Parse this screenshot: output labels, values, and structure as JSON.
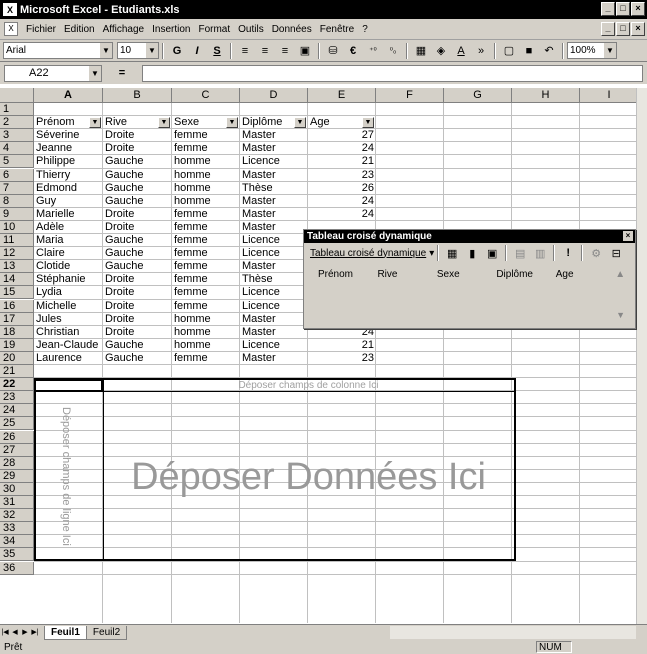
{
  "titlebar": {
    "title": "Microsoft Excel - Etudiants.xls",
    "minimize": "_",
    "restore": "□",
    "close": "×"
  },
  "menubar": {
    "items": [
      "Fichier",
      "Edition",
      "Affichage",
      "Insertion",
      "Format",
      "Outils",
      "Données",
      "Fenêtre",
      "?"
    ],
    "doc_minimize": "_",
    "doc_restore": "□",
    "doc_close": "×"
  },
  "toolbar": {
    "font": "Arial",
    "size": "10",
    "bold": "G",
    "italic": "I",
    "underline": "S",
    "currency": "€",
    "zoom": "100%"
  },
  "formulabar": {
    "namebox": "A22",
    "eq": "="
  },
  "columns": [
    "A",
    "B",
    "C",
    "D",
    "E",
    "F",
    "G",
    "H",
    "I"
  ],
  "rows": [
    "1",
    "2",
    "3",
    "4",
    "5",
    "6",
    "7",
    "8",
    "9",
    "10",
    "11",
    "12",
    "13",
    "14",
    "15",
    "16",
    "17",
    "18",
    "19",
    "20",
    "21",
    "22",
    "23",
    "24",
    "25",
    "26",
    "27",
    "28",
    "29",
    "30",
    "31",
    "32",
    "33",
    "34",
    "35",
    "36"
  ],
  "headers": [
    "Prénom",
    "Rive",
    "Sexe",
    "Diplôme",
    "Age"
  ],
  "table": [
    [
      "Séverine",
      "Droite",
      "femme",
      "Master",
      "27"
    ],
    [
      "Jeanne",
      "Droite",
      "femme",
      "Master",
      "24"
    ],
    [
      "Philippe",
      "Gauche",
      "homme",
      "Licence",
      "21"
    ],
    [
      "Thierry",
      "Gauche",
      "homme",
      "Master",
      "23"
    ],
    [
      "Edmond",
      "Gauche",
      "homme",
      "Thèse",
      "26"
    ],
    [
      "Guy",
      "Gauche",
      "homme",
      "Master",
      "24"
    ],
    [
      "Marielle",
      "Droite",
      "femme",
      "Master",
      "24"
    ],
    [
      "Adèle",
      "Droite",
      "femme",
      "Master",
      ""
    ],
    [
      "Maria",
      "Gauche",
      "femme",
      "Licence",
      ""
    ],
    [
      "Claire",
      "Gauche",
      "femme",
      "Licence",
      ""
    ],
    [
      "Clotide",
      "Gauche",
      "femme",
      "Master",
      ""
    ],
    [
      "Stéphanie",
      "Droite",
      "femme",
      "Thèse",
      ""
    ],
    [
      "Lydia",
      "Droite",
      "femme",
      "Licence",
      ""
    ],
    [
      "Michelle",
      "Droite",
      "femme",
      "Licence",
      ""
    ],
    [
      "Jules",
      "Droite",
      "homme",
      "Master",
      "24"
    ],
    [
      "Christian",
      "Droite",
      "homme",
      "Master",
      "24"
    ],
    [
      "Jean-Claude",
      "Gauche",
      "homme",
      "Licence",
      "21"
    ],
    [
      "Laurence",
      "Gauche",
      "femme",
      "Master",
      "23"
    ]
  ],
  "pivot_area": {
    "col_zone": "Déposer champs de colonne Ici",
    "data_zone": "Déposer Données Ici",
    "row_zone": "Déposer champs de ligne Ici"
  },
  "pivot_toolbar": {
    "title": "Tableau croisé dynamique",
    "menu": "Tableau croisé dynamique",
    "fields": [
      "Prénom",
      "Rive",
      "Sexe",
      "Diplôme",
      "Age"
    ]
  },
  "sheets": [
    "Feuil1",
    "Feuil2"
  ],
  "status": {
    "ready": "Prêt",
    "num": "NUM"
  }
}
